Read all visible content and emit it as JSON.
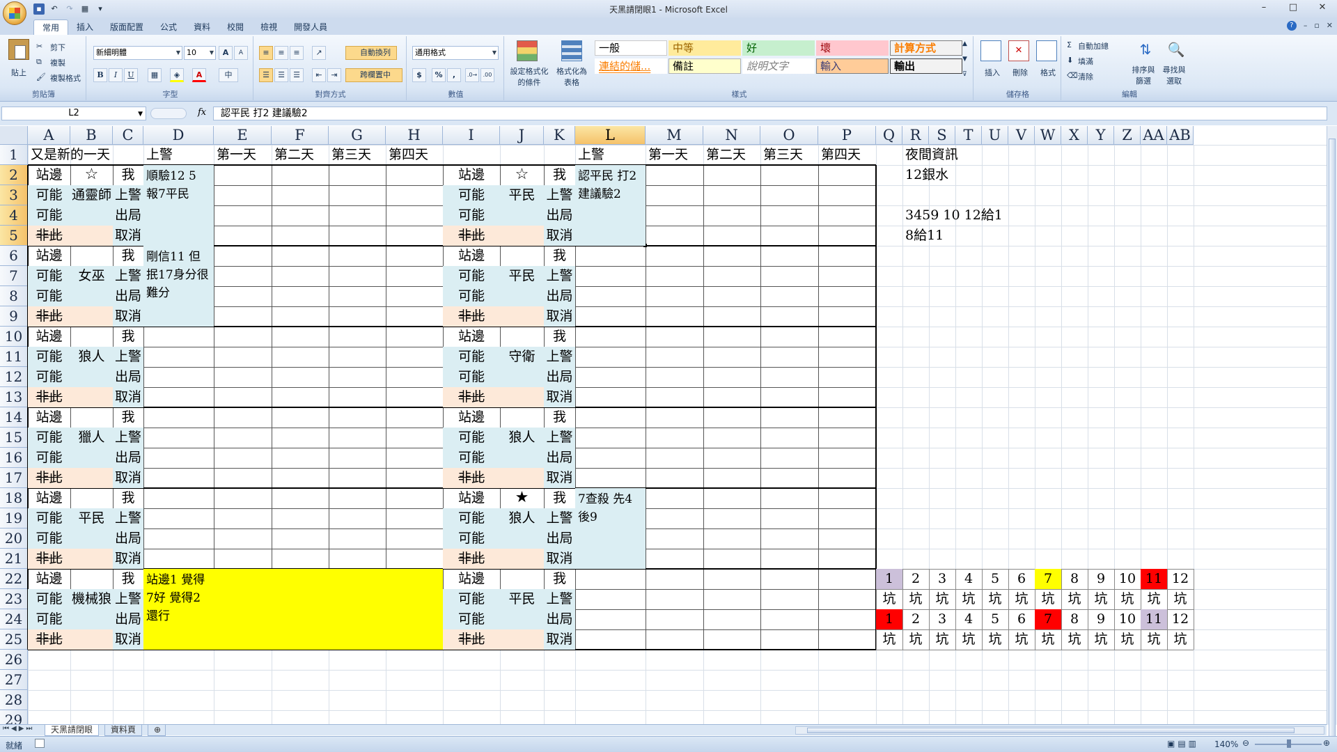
{
  "window": {
    "title": "天黑請閉眼1 - Microsoft Excel",
    "controls": [
      "–",
      "□",
      "✕"
    ]
  },
  "qat": {
    "items": [
      "save",
      "undo",
      "redo",
      "view",
      "customize"
    ]
  },
  "ribbon": {
    "tabs": [
      "常用",
      "插入",
      "版面配置",
      "公式",
      "資料",
      "校閱",
      "檢視",
      "開發人員"
    ],
    "active_tab": "常用",
    "clipboard": {
      "paste": "貼上",
      "cut": "剪下",
      "copy": "複製",
      "format_painter": "複製格式",
      "label": "剪貼簿"
    },
    "font": {
      "name": "新細明體",
      "size": "10",
      "grow": "A",
      "shrink": "A",
      "bold": "B",
      "italic": "I",
      "underline": "U",
      "label": "字型"
    },
    "alignment": {
      "wrap": "自動換列",
      "merge": "跨欄置中",
      "label": "對齊方式"
    },
    "number": {
      "format": "通用格式",
      "currency": "$",
      "percent": "%",
      "comma": ",",
      "label": "數值"
    },
    "styles": {
      "cond_format": "設定格式化的條件",
      "table_format": "格式化為表格",
      "label": "樣式",
      "cells": [
        {
          "text": "一般",
          "bg": "#ffffff",
          "fg": "#000000",
          "border": "#c9c9c9"
        },
        {
          "text": "中等",
          "bg": "#ffeb9c",
          "fg": "#9c6500",
          "border": "#ffeb9c"
        },
        {
          "text": "好",
          "bg": "#c6efce",
          "fg": "#006100",
          "border": "#c6efce"
        },
        {
          "text": "壞",
          "bg": "#ffc7ce",
          "fg": "#9c0006",
          "border": "#ffc7ce"
        },
        {
          "text": "計算方式",
          "bg": "#f2f2f2",
          "fg": "#fa7d00",
          "border": "#7f7f7f"
        },
        {
          "text": "連結的儲...",
          "bg": "#ffffff",
          "fg": "#fa7d00",
          "border": "#ffffff"
        },
        {
          "text": "備註",
          "bg": "#ffffcc",
          "fg": "#000000",
          "border": "#b2b2b2"
        },
        {
          "text": "說明文字",
          "bg": "#ffffff",
          "fg": "#7f7f7f",
          "border": "#ffffff"
        },
        {
          "text": "輸入",
          "bg": "#ffcc99",
          "fg": "#3f3f76",
          "border": "#7f7f7f"
        },
        {
          "text": "輸出",
          "bg": "#f2f2f2",
          "fg": "#000000",
          "border": "#3f3f3f"
        }
      ]
    },
    "cells_group": {
      "insert": "插入",
      "delete": "刪除",
      "format": "格式",
      "label": "儲存格"
    },
    "editing": {
      "autosum": "自動加總",
      "fill": "填滿",
      "clear": "清除",
      "sort": "排序與篩選",
      "find": "尋找與選取",
      "label": "編輯"
    }
  },
  "formula_bar": {
    "name_box": "L2",
    "fx": "fx",
    "content": "認平民 打2 建議驗2"
  },
  "columns": [
    "A",
    "B",
    "C",
    "D",
    "E",
    "F",
    "G",
    "H",
    "I",
    "J",
    "K",
    "L",
    "M",
    "N",
    "O",
    "P",
    "Q",
    "R",
    "S",
    "T",
    "U",
    "V",
    "W",
    "X",
    "Y",
    "Z",
    "AA",
    "AB"
  ],
  "rows": [
    "1",
    "2",
    "3",
    "4",
    "5",
    "6",
    "7",
    "8",
    "9",
    "10",
    "11",
    "12",
    "13",
    "14",
    "15",
    "16",
    "17",
    "18",
    "19",
    "20",
    "21",
    "22",
    "23",
    "24",
    "25",
    "26",
    "27",
    "28",
    "29"
  ],
  "sheet": {
    "a1": "又是新的一天",
    "left_headers": [
      "上警",
      "第一天",
      "第二天",
      "第三天",
      "第四天"
    ],
    "right_headers": [
      "上警",
      "第一天",
      "第二天",
      "第三天",
      "第四天"
    ],
    "night_info": "夜間資訊",
    "block_labels": {
      "side": "站邊",
      "maybe": "可能",
      "not": "非此",
      "me": "我",
      "up": "上警",
      "out": "出局",
      "cancel": "取消"
    },
    "left_roles": [
      "☆",
      "通靈師",
      "女巫",
      "狼人",
      "獵人",
      "平民",
      "機械狼"
    ],
    "right_roles": [
      "☆",
      "平民",
      "平民",
      "守衛",
      "狼人",
      "★",
      "狼人",
      "平民"
    ],
    "left_notes": [
      "順驗12 5 報7平民",
      "剛信11 但抿17身分很難分",
      "站邊1 覺得7好 覺得2還行"
    ],
    "right_notes": [
      "認平民 打2 建議驗2",
      "7查殺 先4後9"
    ],
    "night_lines": [
      "12銀水",
      "3459 10 12給1",
      "8給11"
    ],
    "pits": [
      "1",
      "2",
      "3",
      "4",
      "5",
      "6",
      "7",
      "8",
      "9",
      "10",
      "11",
      "12"
    ],
    "pit_label": "坑",
    "pit_row1_colors": [
      "#ccc0da",
      "",
      "",
      "",
      "",
      "",
      "#ffff00",
      "",
      "",
      "",
      "#ff0000",
      ""
    ],
    "pit_row2_colors": [
      "#ff0000",
      "",
      "",
      "",
      "",
      "",
      "#ff0000",
      "",
      "",
      "",
      "#ccc0da",
      ""
    ]
  },
  "sheet_tabs": [
    "天黑請閉眼",
    "資料頁"
  ],
  "status": {
    "ready": "就緒",
    "zoom": "140%"
  },
  "colors": {
    "light_blue": "#dbeef3",
    "light_pink": "#fde9d9",
    "yellow": "#ffff00",
    "accent": "#f5c26a"
  }
}
